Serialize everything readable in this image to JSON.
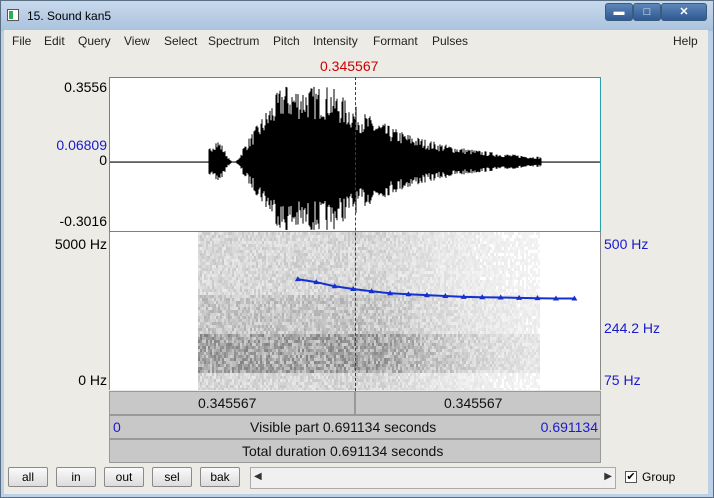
{
  "window": {
    "title": "15. Sound kan5",
    "minimize_glyph": "▬",
    "maximize_glyph": "□",
    "close_glyph": "✕"
  },
  "menu": [
    "File",
    "Edit",
    "Query",
    "View",
    "Select",
    "Spectrum",
    "Pitch",
    "Intensity",
    "Formant",
    "Pulses"
  ],
  "help_label": "Help",
  "cursor": {
    "time_label": "0.345567",
    "time_s": 0.345567
  },
  "waveform": {
    "y_max": "0.3556",
    "y_cursor_value": "0.06809",
    "y_zero": "0",
    "y_min": "-0.3016"
  },
  "spectrogram": {
    "freq_top": "5000 Hz",
    "freq_bottom": "0 Hz",
    "pitch_top": "500 Hz",
    "pitch_mid": "244.2 Hz",
    "pitch_bottom": "75 Hz"
  },
  "pitch_contour": {
    "t_start": 0.265,
    "t_end": 0.655,
    "hz": [
      300,
      288,
      272,
      262,
      254,
      247,
      244,
      241,
      238,
      235,
      234,
      233,
      232,
      231,
      230,
      230
    ]
  },
  "time_bars": {
    "left_segment": "0.345567",
    "right_segment": "0.345567",
    "visible_start": "0",
    "visible_label": "Visible part 0.691134 seconds",
    "visible_end": "0.691134",
    "total_label": "Total duration 0.691134 seconds",
    "total_s": 0.691134
  },
  "footer": {
    "buttons": [
      "all",
      "in",
      "out",
      "sel",
      "bak"
    ],
    "group_label": "Group",
    "group_checked": true,
    "left_arrow": "◀",
    "right_arrow": "▶"
  },
  "colors": {
    "cursor": "#cc0000",
    "blue_text": "#1a1acc",
    "pitch_line": "#1530d0"
  }
}
